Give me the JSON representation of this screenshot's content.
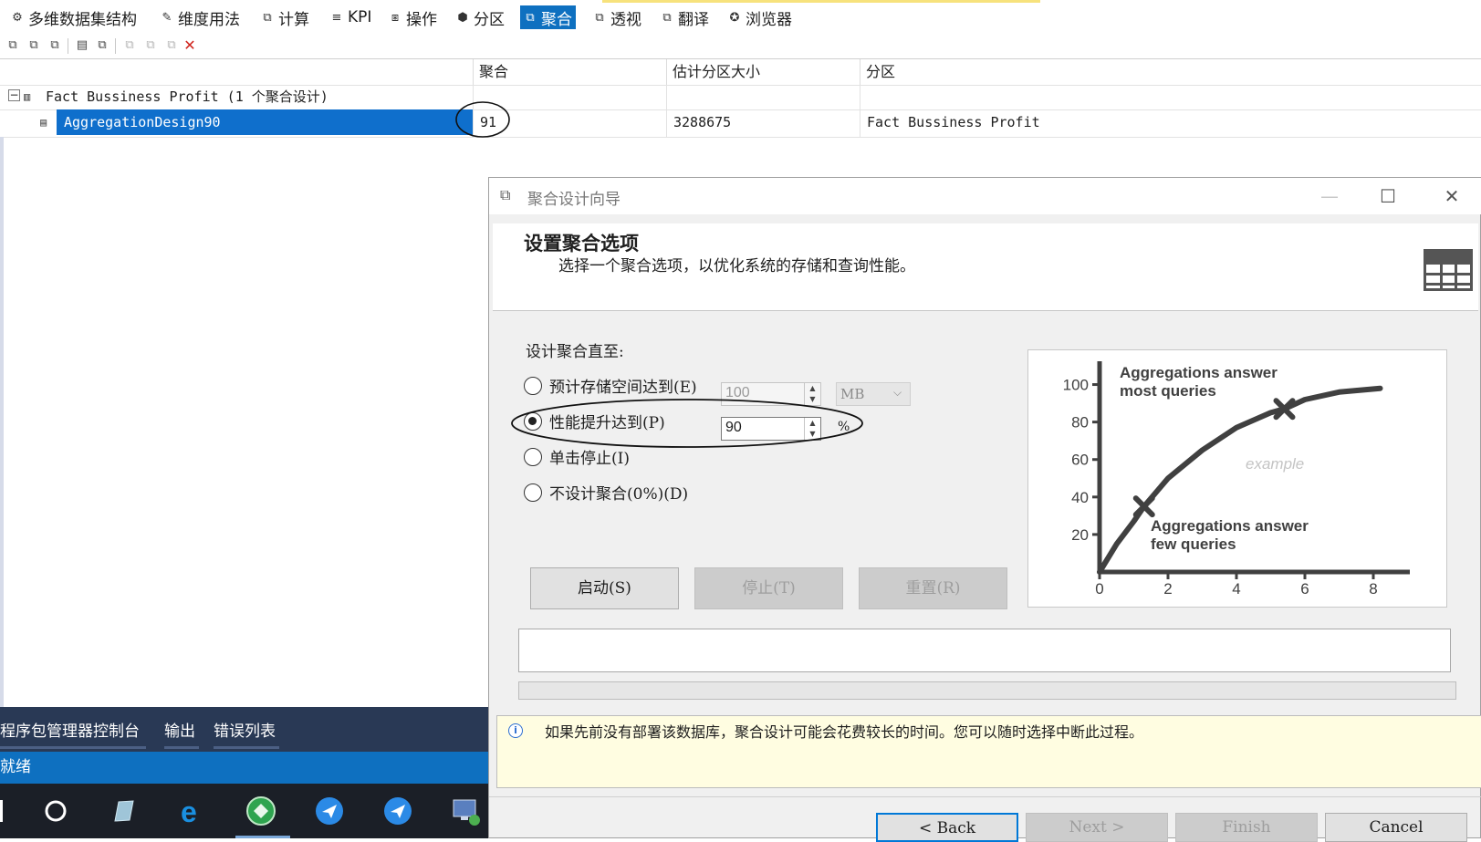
{
  "tabs": [
    {
      "label": "多维数据集结构",
      "icon": "cube-structure-icon"
    },
    {
      "label": "维度用法",
      "icon": "dimension-usage-icon"
    },
    {
      "label": "计算",
      "icon": "calculation-icon"
    },
    {
      "label": "KPI",
      "icon": "kpi-icon"
    },
    {
      "label": "操作",
      "icon": "action-icon"
    },
    {
      "label": "分区",
      "icon": "partition-icon"
    },
    {
      "label": "聚合",
      "icon": "aggregation-icon"
    },
    {
      "label": "透视",
      "icon": "perspective-icon"
    },
    {
      "label": "翻译",
      "icon": "translation-icon"
    },
    {
      "label": "浏览器",
      "icon": "browser-icon"
    }
  ],
  "active_tab": "聚合",
  "grid": {
    "columns": [
      "聚合",
      "估计分区大小",
      "分区"
    ],
    "group_label": "Fact Bussiness Profit (1 个聚合设计)",
    "rows": [
      {
        "name": "AggregationDesign90",
        "aggregations": "91",
        "estimated_size": "3288675",
        "partition": "Fact Bussiness Profit"
      }
    ]
  },
  "bottom_panes": [
    "程序包管理器控制台",
    "输出",
    "错误列表"
  ],
  "status": "就绪",
  "dialog": {
    "title": "聚合设计向导",
    "heading": "设置聚合选项",
    "subheading": "选择一个聚合选项，以优化系统的存储和查询性能。",
    "design_until_label": "设计聚合直至:",
    "options": [
      {
        "label": "预计存储空间达到(E)",
        "checked": false
      },
      {
        "label": "性能提升达到(P)",
        "checked": true
      },
      {
        "label": "单击停止(I)",
        "checked": false
      },
      {
        "label": "不设计聚合(0%)(D)",
        "checked": false
      }
    ],
    "storage_value": "100",
    "storage_unit": "MB",
    "performance_value": "90",
    "performance_unit": "%",
    "buttons": {
      "start": "启动(S)",
      "stop": "停止(T)",
      "reset": "重置(R)"
    },
    "info_text": "如果先前没有部署该数据库，聚合设计可能会花费较长的时间。您可以随时选择中断此过程。",
    "nav": {
      "back": "< Back",
      "next": "Next >",
      "finish": "Finish",
      "cancel": "Cancel"
    }
  },
  "chart_data": {
    "type": "line",
    "x": [
      0,
      0.5,
      1,
      1.3,
      2,
      3,
      4,
      5,
      5.4,
      6,
      7,
      8.2
    ],
    "values": [
      0,
      15,
      27,
      35,
      50,
      65,
      77,
      85,
      87,
      92,
      96,
      98
    ],
    "markers": [
      {
        "x": 1.3,
        "y": 35
      },
      {
        "x": 5.4,
        "y": 87
      }
    ],
    "x_ticks": [
      "0",
      "2",
      "4",
      "6",
      "8"
    ],
    "y_ticks": [
      "20",
      "40",
      "60",
      "80",
      "100"
    ],
    "xlim": [
      0,
      8.8
    ],
    "ylim": [
      0,
      110
    ],
    "annotations": {
      "top_line1": "Aggregations answer",
      "top_line2": "most queries",
      "bottom_line1": "Aggregations answer",
      "bottom_line2": "few queries",
      "watermark": "example"
    },
    "line_color": "#404040"
  }
}
